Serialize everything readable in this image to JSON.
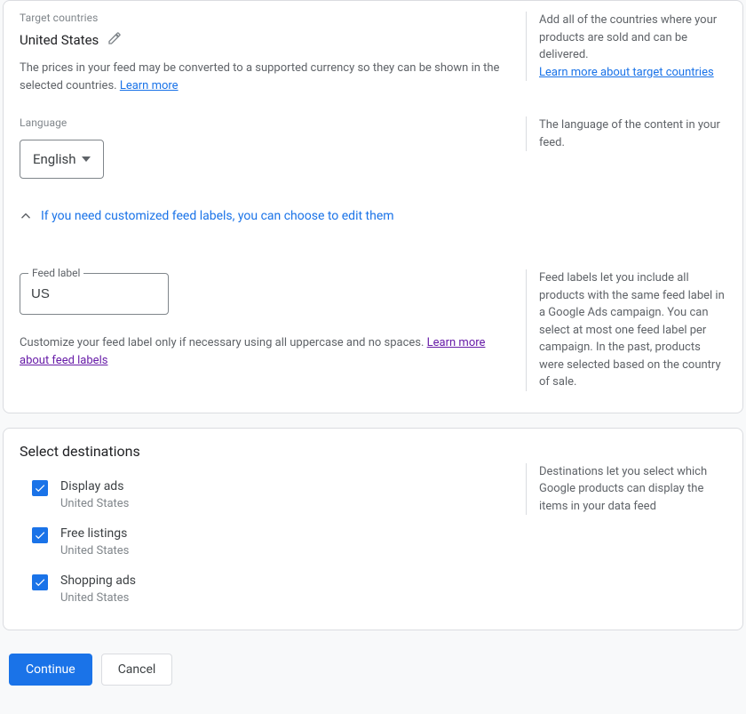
{
  "target": {
    "label": "Target countries",
    "country": "United States",
    "helper_pre": "The prices in your feed may be converted to a supported currency so they can be shown in the selected countries. ",
    "helper_link": "Learn more",
    "aside": "Add all of the countries where your products are sold and can be delivered.",
    "aside_link": "Learn more about target countries"
  },
  "language": {
    "label": "Language",
    "value": "English",
    "aside": "The language of the content in your feed."
  },
  "feed_label_toggle": "If you need customized feed labels, you can choose to edit them",
  "feed_label": {
    "field_label": "Feed label",
    "value": "US",
    "helper_pre": "Customize your feed label only if necessary using all uppercase and no spaces. ",
    "helper_link": "Learn more about feed labels",
    "aside": "Feed labels let you include all products with the same feed label in a Google Ads campaign. You can select at most one feed label per campaign. In the past, products were selected based on the country of sale."
  },
  "destinations": {
    "title": "Select destinations",
    "aside": "Destinations let you select which Google products can display the items in your data feed",
    "items": [
      {
        "title": "Display ads",
        "sub": "United States"
      },
      {
        "title": "Free listings",
        "sub": "United States"
      },
      {
        "title": "Shopping ads",
        "sub": "United States"
      }
    ]
  },
  "actions": {
    "continue": "Continue",
    "cancel": "Cancel"
  }
}
